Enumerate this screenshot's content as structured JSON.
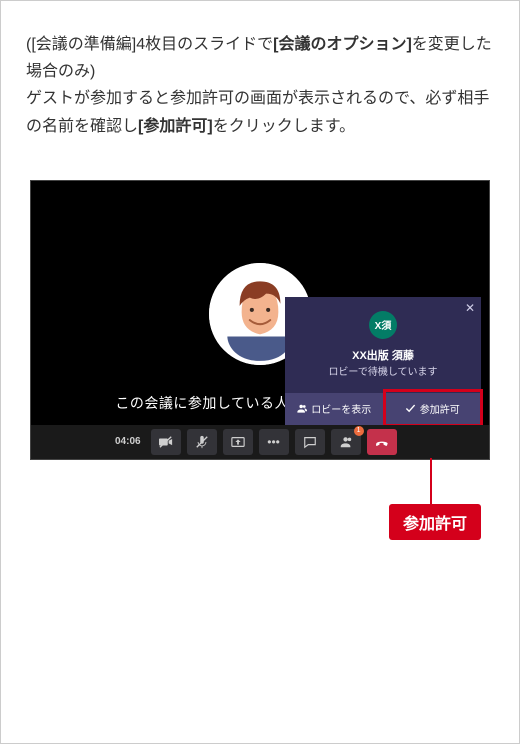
{
  "paragraph": {
    "l1a": "([会議の準備編]4枚目のスライドで",
    "l1b": "[会議のオプション]",
    "l1c": "を変更した場合のみ)",
    "l2a": "ゲストが参加すると参加許可の画面が表示されるので、必ず相手の名前を確認し",
    "l2b": "[参加許可]",
    "l2c": "をクリックします。"
  },
  "caption": "この会議に参加している人は他にいません。",
  "popup": {
    "avatar_initials": "X須",
    "name": "XX出版 須藤",
    "sub": "ロビーで待機しています",
    "lobby_label": "ロビーを表示",
    "admit_label": "参加許可"
  },
  "toolbar": {
    "timer": "04:06",
    "people_badge": "1"
  },
  "callout": "参加許可"
}
